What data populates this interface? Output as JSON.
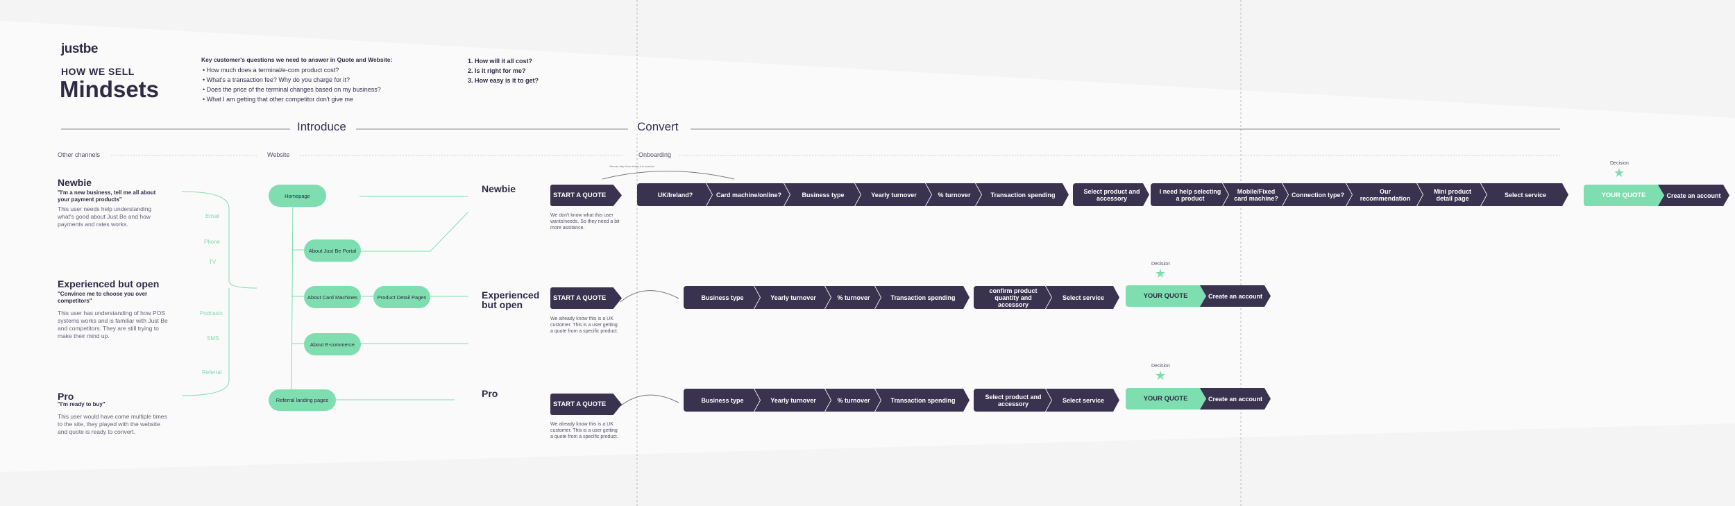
{
  "brand": {
    "logo": "justbe"
  },
  "header": {
    "eyebrow": "HOW WE SELL",
    "title": "Mindsets",
    "questions_heading": "Key customer's questions we need to answer in Quote and Website:",
    "questions": [
      "How much does a terminal/e-com product cost?",
      "What's a transaction fee? Why do you charge for it?",
      "Does the price of the terminal changes based on my business?",
      "What I am getting that other competitor don't give me"
    ],
    "numbered": [
      "1. How will it all cost?",
      "2. Is it right for me?",
      "3. How easy is it to get?"
    ]
  },
  "stages": {
    "introduce": "Introduce",
    "convert": "Convert"
  },
  "subheads": {
    "other_channels": "Other channels",
    "website": "Website",
    "onboarding": "Onboarding"
  },
  "personas": [
    {
      "name": "Newbie",
      "quote": "\"I'm a new business, tell me all about your payment products\"",
      "desc": "This user needs help understanding what's good about Just Be and how payments and rates works."
    },
    {
      "name": "Experienced but open",
      "quote": "\"Convince me to choose you over competitors\"",
      "desc": "This user has understanding of how POS systems works and is familiar with Just Be and competitors. They are still trying to make their mind up."
    },
    {
      "name": "Pro",
      "quote": "\"I'm ready to buy\"",
      "desc": "This user would have come multiple times to the site, they played with the website and quote is ready to convert."
    }
  ],
  "channels": [
    "Email",
    "Phone",
    "TV",
    "Podcasts",
    "SMS",
    "Referral"
  ],
  "website_pages": {
    "homepage": "Homepage",
    "portal": "About Just Be Portal",
    "card": "About Card Machines",
    "pdp": "Product Detail Pages",
    "ecom": "About E-commerce",
    "referral": "Referral landing pages"
  },
  "rows": {
    "newbie": {
      "label": "Newbie",
      "start": "START A QUOTE",
      "note": "We don't know what this user wants/needs. So they need a bit more assitance.",
      "tiny": "We can skip if we detect it in session",
      "steps": [
        "UK/Ireland?",
        "Card machine/online?",
        "Business type",
        "Yearly turnover",
        "% turnover",
        "Transaction spending"
      ],
      "steps2": [
        "Select product and accessory",
        "I need help selecting a product",
        "Mobile/Fixed card machine?",
        "Connection type?",
        "Our recommendation",
        "Mini product detail page",
        "Select service"
      ],
      "decision": "Decision",
      "quote": "YOUR QUOTE",
      "create": "Create an account"
    },
    "experienced": {
      "label": "Experienced but open",
      "start": "START A QUOTE",
      "note": "We already know this is a UK customer. This is a user getting a quote  from a specific product.",
      "steps": [
        "Business type",
        "Yearly turnover",
        "% turnover",
        "Transaction spending"
      ],
      "steps2": [
        "confirm product quantity and accessory",
        "Select service"
      ],
      "decision": "Decision",
      "quote": "YOUR QUOTE",
      "create": "Create an account"
    },
    "pro": {
      "label": "Pro",
      "start": "START A QUOTE",
      "note": "We already know this is a UK customer. This is a user getting a quote  from a specific product.",
      "steps": [
        "Business type",
        "Yearly turnover",
        "% turnover",
        "Transaction spending"
      ],
      "steps2": [
        "Select product and accessory",
        "Select service"
      ],
      "decision": "Decision",
      "quote": "YOUR QUOTE",
      "create": "Create an account"
    }
  },
  "colors": {
    "navy": "#3a3350",
    "mint": "#7fdeb0",
    "text": "#2f2a45"
  }
}
